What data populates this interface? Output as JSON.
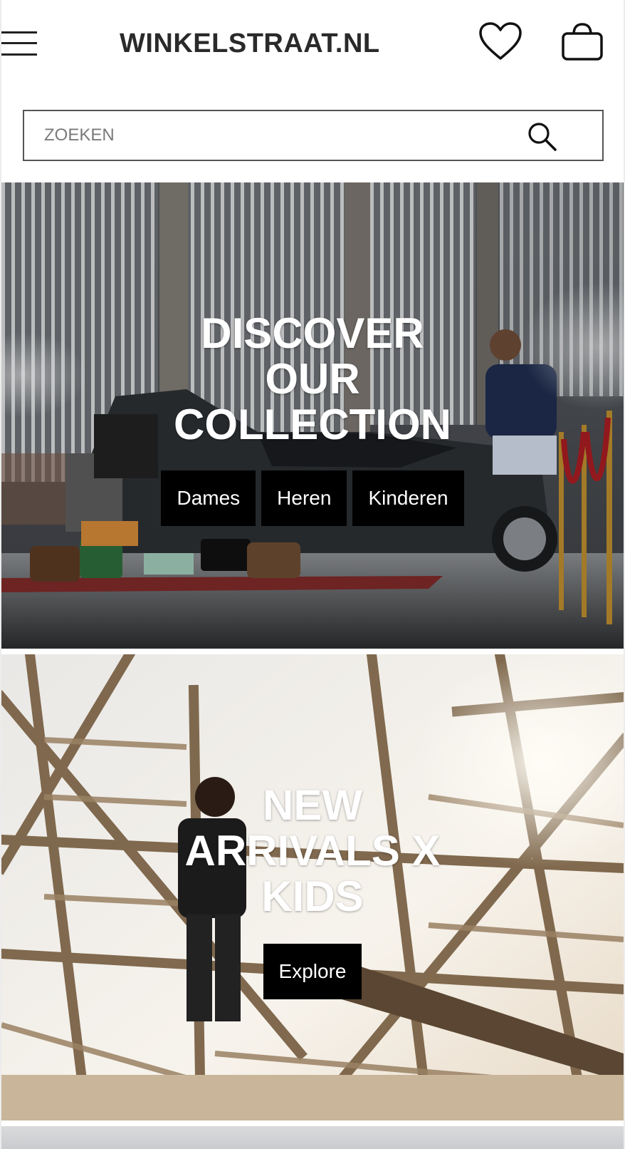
{
  "header": {
    "logo": "WINKELSTRAAT.NL",
    "icons": {
      "menu": "hamburger-menu-icon",
      "wishlist": "heart-icon",
      "cart": "shopping-bag-icon"
    }
  },
  "search": {
    "placeholder": "ZOEKEN",
    "value": "",
    "icon": "search-icon"
  },
  "hero_collection": {
    "title_lines": [
      "DISCOVER",
      "OUR",
      "COLLECTION"
    ],
    "buttons": [
      "Dames",
      "Heren",
      "Kinderen"
    ]
  },
  "hero_kids": {
    "title_lines": [
      "NEW",
      "ARRIVALS X",
      "KIDS"
    ],
    "button": "Explore"
  },
  "colors": {
    "text_dark": "#2a2a2a",
    "button_bg": "#000000",
    "button_text": "#ffffff",
    "search_border": "#555555"
  }
}
